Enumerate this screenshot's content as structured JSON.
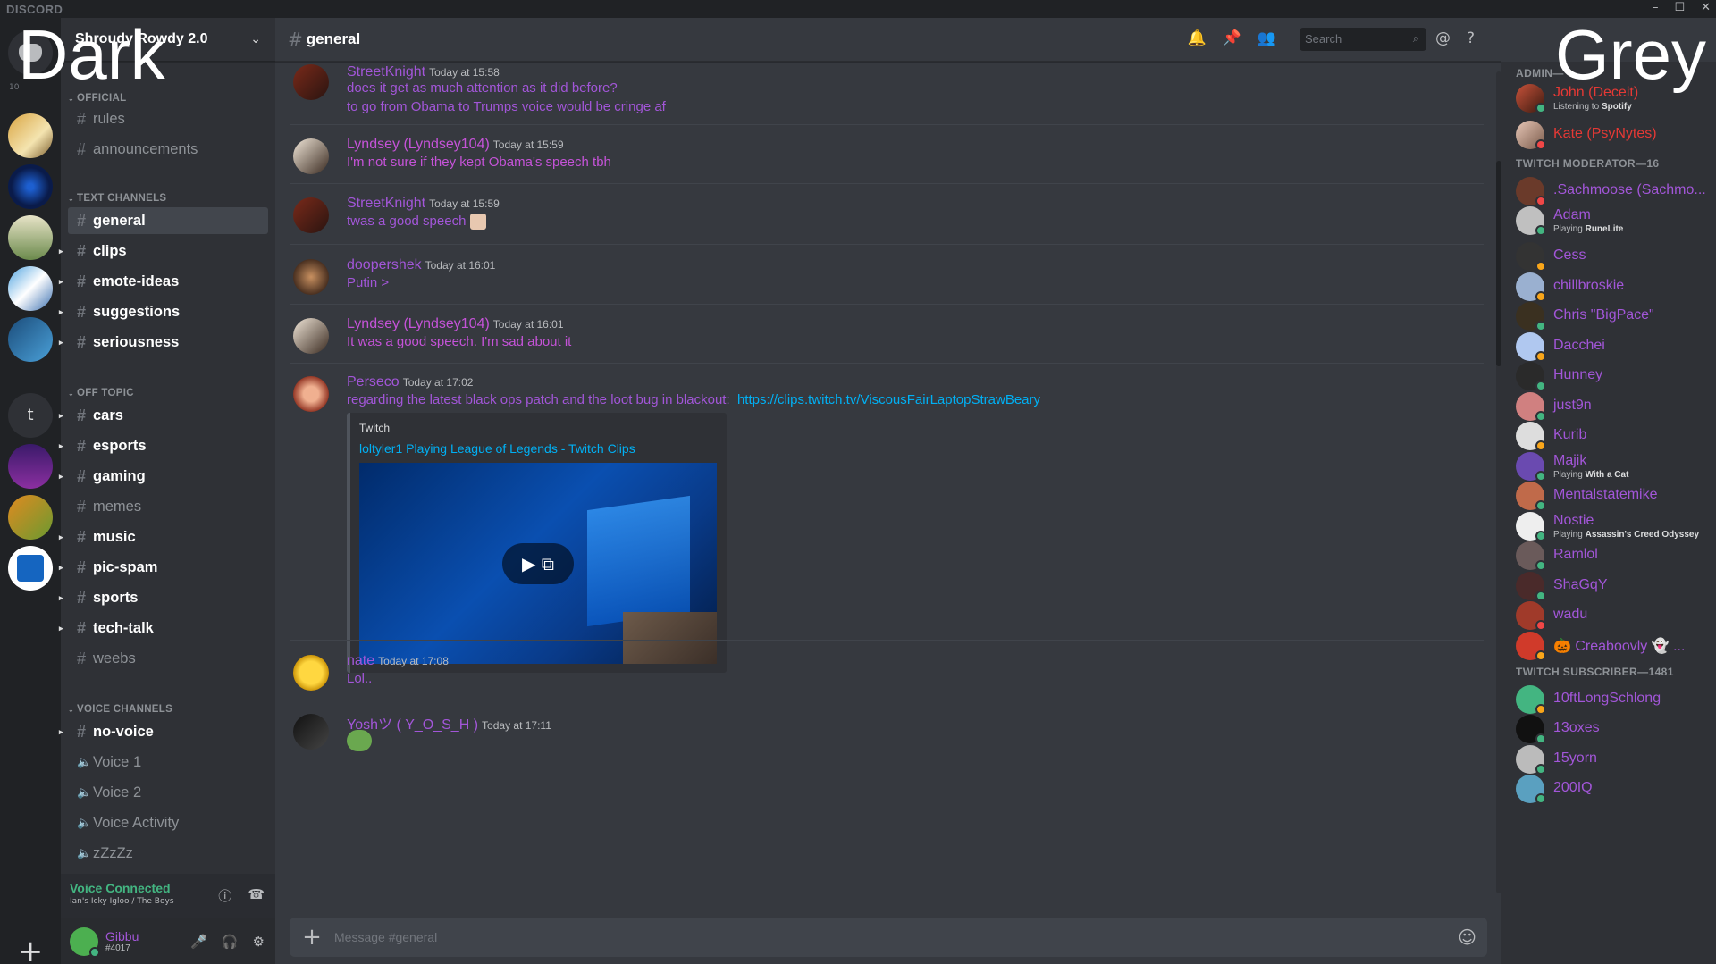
{
  "titlebar": {
    "brand": "DISCORD",
    "minimize": "–",
    "maximize": "☐",
    "close": "✕"
  },
  "overlay": {
    "left_word": "Dark",
    "right_word": "Grey"
  },
  "guilds": {
    "online_count": "10",
    "add_label": "+",
    "t_label": "t"
  },
  "server": {
    "name": "Shroudy Rowdy 2.0"
  },
  "categories": {
    "official": "OFFICIAL",
    "text": "TEXT CHANNELS",
    "offtopic": "OFF TOPIC",
    "voice": "VOICE CHANNELS"
  },
  "channels": {
    "rules": "rules",
    "announcements": "announcements",
    "general": "general",
    "clips": "clips",
    "emote_ideas": "emote-ideas",
    "suggestions": "suggestions",
    "seriousness": "seriousness",
    "cars": "cars",
    "esports": "esports",
    "gaming": "gaming",
    "memes": "memes",
    "music": "music",
    "pic_spam": "pic-spam",
    "sports": "sports",
    "tech_talk": "tech-talk",
    "weebs": "weebs",
    "no_voice": "no-voice",
    "voice1": "Voice 1",
    "voice2": "Voice 2",
    "voice_activity": "Voice Activity",
    "zzzz": "zZzZz"
  },
  "voice_status": {
    "label": "Voice Connected",
    "location": "Ian's Icky Igloo / The Boys"
  },
  "user": {
    "name": "Gibbu",
    "tag": "#4017"
  },
  "header": {
    "channel": "general",
    "search_placeholder": "Search"
  },
  "messages": [
    {
      "author": "StreetKnight",
      "time": "Today at 15:58",
      "lines": [
        "does it get as much attention as it did before?",
        "to go from Obama to Trumps voice would be cringe af"
      ]
    },
    {
      "author": "Lyndsey (Lyndsey104)",
      "time": "Today at 15:59",
      "lines": [
        "I'm not sure if they kept Obama's speech tbh"
      ]
    },
    {
      "author": "StreetKnight",
      "time": "Today at 15:59",
      "lines": [
        "twas a good speech"
      ]
    },
    {
      "author": "doopershek",
      "time": "Today at 16:01",
      "lines": [
        "Putin >"
      ]
    },
    {
      "author": "Lyndsey (Lyndsey104)",
      "time": "Today at 16:01",
      "lines": [
        "It was a good speech. I'm sad about it"
      ]
    },
    {
      "author": "Perseco",
      "time": "Today at 17:02",
      "lines": [
        "regarding the latest black ops patch and the loot bug in blackout:"
      ],
      "link": "https://clips.twitch.tv/ViscousFairLaptopStrawBeary"
    },
    {
      "author": "nate",
      "time": "Today at 17:08",
      "lines": [
        "Lol.."
      ]
    },
    {
      "author": "Yoshツ ( Y_O_S_H )",
      "time": "Today at 17:11",
      "lines": [
        ""
      ]
    }
  ],
  "embed": {
    "provider": "Twitch",
    "title": "loltyler1 Playing League of Legends - Twitch Clips"
  },
  "composer": {
    "placeholder": "Message #general"
  },
  "members": {
    "admin_cat": "ADMIN—",
    "mod_cat": "TWITCH MODERATOR—16",
    "sub_cat": "TWITCH SUBSCRIBER—1481",
    "admins": [
      {
        "name": "John (Deceit)",
        "activity_prefix": "Listening to",
        "activity": "Spotify"
      },
      {
        "name": "Kate (PsyNytes)"
      }
    ],
    "mods": [
      {
        "name": ".Sachmoose (Sachmo..."
      },
      {
        "name": "Adam",
        "activity_prefix": "Playing",
        "activity": "RuneLite"
      },
      {
        "name": "Cess"
      },
      {
        "name": "chillbroskie"
      },
      {
        "name": "Chris \"BigPace\""
      },
      {
        "name": "Dacchei"
      },
      {
        "name": "Hunney"
      },
      {
        "name": "just9n"
      },
      {
        "name": "Kurib"
      },
      {
        "name": "Majik",
        "activity_prefix": "Playing",
        "activity": "With a Cat"
      },
      {
        "name": "Mentalstatemike"
      },
      {
        "name": "Nostie",
        "activity_prefix": "Playing",
        "activity": "Assassin's Creed Odyssey"
      },
      {
        "name": "Ramlol"
      },
      {
        "name": "ShaGqY"
      },
      {
        "name": "wadu"
      },
      {
        "name": "🎃 Creaboovly 👻 ..."
      }
    ],
    "subs": [
      {
        "name": "10ftLongSchlong"
      },
      {
        "name": "13oxes"
      },
      {
        "name": "15yorn"
      },
      {
        "name": "200IQ"
      }
    ]
  },
  "colors": {
    "accent": "#a256d8",
    "link": "#00b0f4",
    "online": "#43b581",
    "admin_red": "#e53935"
  }
}
